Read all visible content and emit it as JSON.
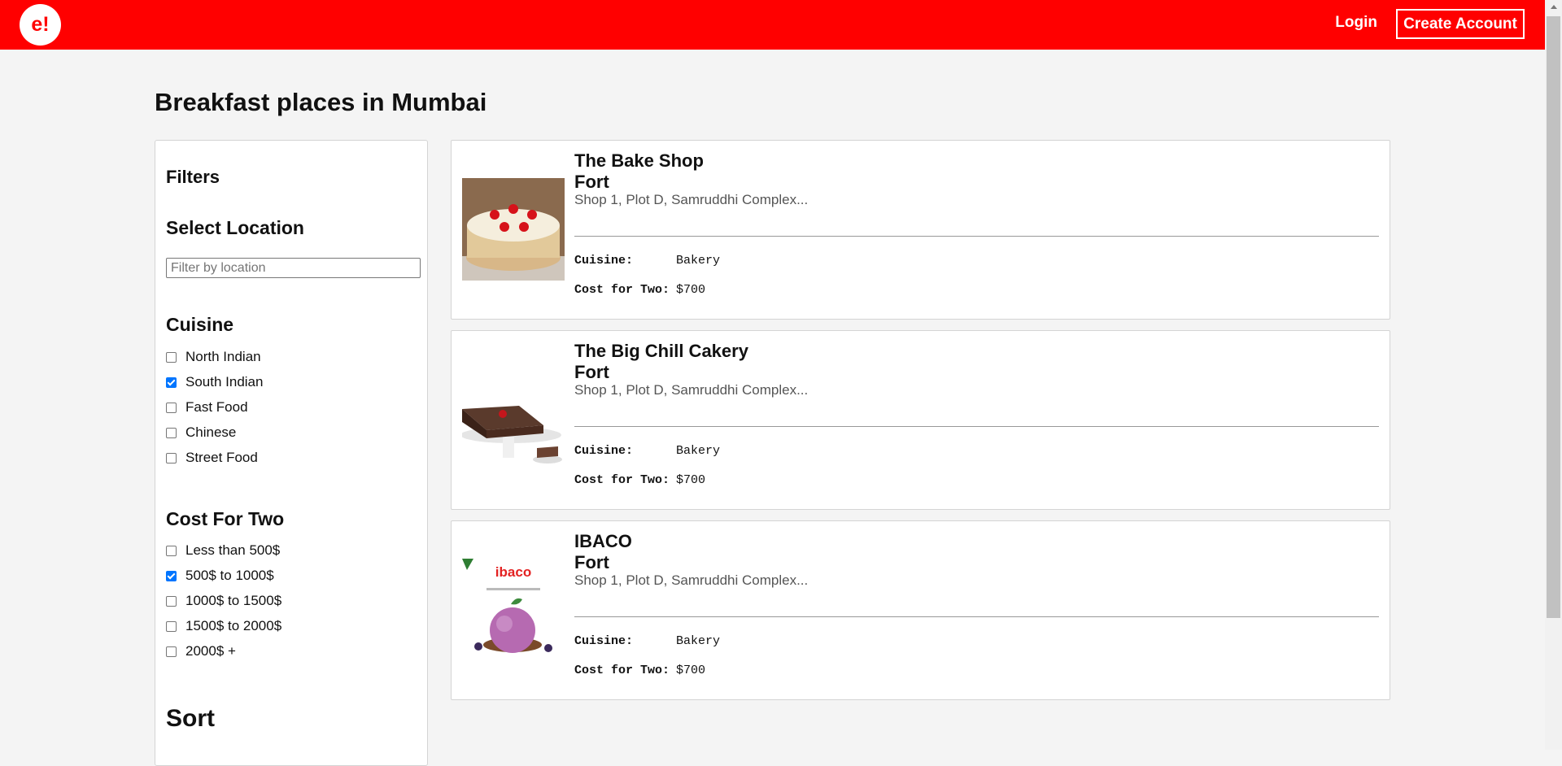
{
  "header": {
    "logo": "e!",
    "login": "Login",
    "create_account": "Create Account"
  },
  "page_title": "Breakfast places in Mumbai",
  "filters": {
    "title": "Filters",
    "location_heading": "Select Location",
    "location_placeholder": "Filter by location",
    "cuisine_heading": "Cuisine",
    "cuisines": [
      {
        "label": "North Indian",
        "checked": false
      },
      {
        "label": "South Indian",
        "checked": true
      },
      {
        "label": "Fast Food",
        "checked": false
      },
      {
        "label": "Chinese",
        "checked": false
      },
      {
        "label": "Street Food",
        "checked": false
      }
    ],
    "cost_heading": "Cost For Two",
    "costs": [
      {
        "label": "Less than 500$",
        "checked": false
      },
      {
        "label": "500$ to 1000$",
        "checked": true
      },
      {
        "label": "1000$ to 1500$",
        "checked": false
      },
      {
        "label": "1500$ to 2000$",
        "checked": false
      },
      {
        "label": "2000$ +",
        "checked": false
      }
    ],
    "sort_heading": "Sort"
  },
  "restaurants": [
    {
      "name": "The Bake Shop",
      "locality": "Fort",
      "address": "Shop 1, Plot D, Samruddhi Complex...",
      "cuisine_label": "Cuisine:",
      "cuisine": "Bakery",
      "cost_label": "Cost for Two:",
      "cost": "$700"
    },
    {
      "name": "The Big Chill Cakery",
      "locality": "Fort",
      "address": "Shop 1, Plot D, Samruddhi Complex...",
      "cuisine_label": "Cuisine:",
      "cuisine": "Bakery",
      "cost_label": "Cost for Two:",
      "cost": "$700"
    },
    {
      "name": "IBACO",
      "locality": "Fort",
      "address": "Shop 1, Plot D, Samruddhi Complex...",
      "cuisine_label": "Cuisine:",
      "cuisine": "Bakery",
      "cost_label": "Cost for Two:",
      "cost": "$700",
      "image_text": "ibaco"
    }
  ],
  "colors": {
    "brand": "#ff0000",
    "checkbox": "#0075ff"
  }
}
